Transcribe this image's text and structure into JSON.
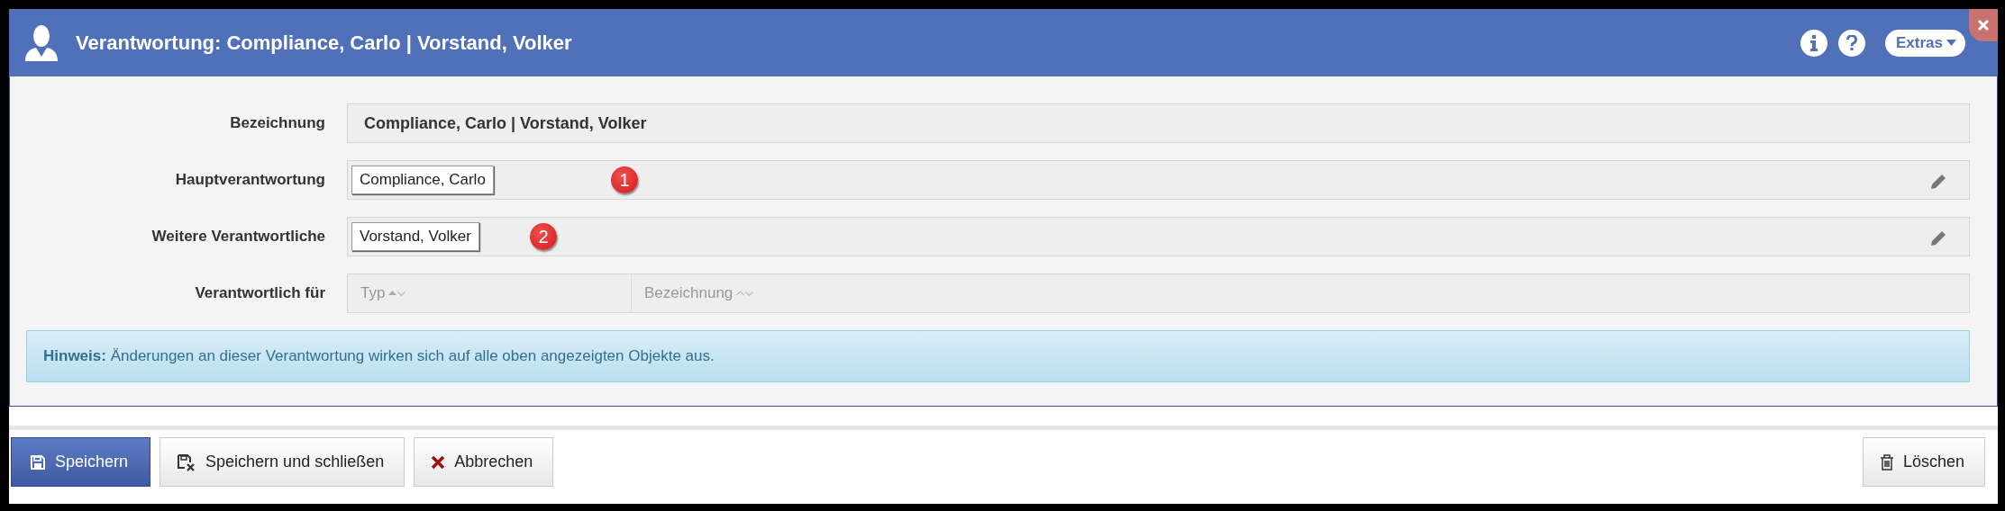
{
  "window": {
    "title": "Verantwortung: Compliance, Carlo | Vorstand, Volker",
    "extras_label": "Extras"
  },
  "fields": [
    {
      "kind": "text",
      "label": "Bezeichnung",
      "value": "Compliance, Carlo | Vorstand, Volker"
    },
    {
      "kind": "picker",
      "label": "Hauptverantwortung",
      "chips": [
        "Compliance, Carlo"
      ],
      "marker": "1"
    },
    {
      "kind": "picker",
      "label": "Weitere Verantwortliche",
      "chips": [
        "Vorstand, Volker"
      ],
      "marker": "2"
    },
    {
      "kind": "table",
      "label": "Verantwortlich für",
      "columns": [
        {
          "label": "Typ",
          "sorted": true
        },
        {
          "label": "Bezeichnung",
          "sorted": false
        }
      ]
    }
  ],
  "hint": "**Hinweis:** Änderungen an dieser Verantwortung wirken sich auf alle oben angezeigten Objekte aus.",
  "buttons": [
    {
      "label": "Speichern",
      "kind": "save"
    },
    {
      "label": "Speichern und schließen",
      "kind": "saveclose"
    },
    {
      "label": "Abbrechen",
      "kind": "cancel"
    },
    {
      "label": "Löschen",
      "kind": "delete"
    }
  ]
}
